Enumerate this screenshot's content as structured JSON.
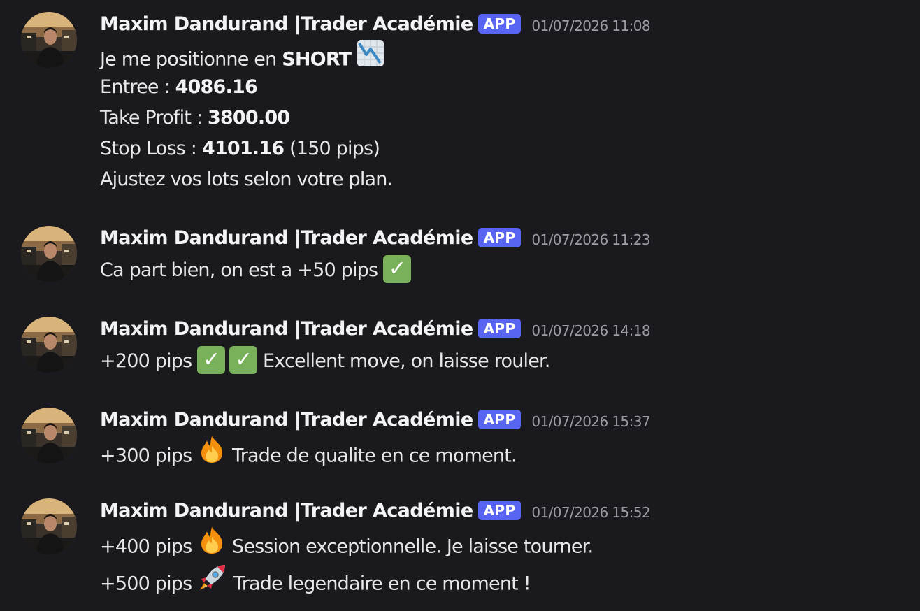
{
  "author": {
    "name": "Maxim Dandurand |Trader Académie",
    "badge": "APP"
  },
  "colors": {
    "background": "#1a1a1e",
    "badge": "#5865f2",
    "check_emoji": "#78b159"
  },
  "messages": [
    {
      "timestamp": "01/07/2026 11:08",
      "lines": [
        {
          "text": "Je me positionne en ",
          "bold": "SHORT",
          "emoji": "chart-decreasing"
        },
        {
          "text": "Entree : ",
          "bold": "4086.16"
        },
        {
          "text": "Take Profit : ",
          "bold": "3800.00"
        },
        {
          "text": "Stop Loss : ",
          "bold": "4101.16",
          "after": " (150 pips)"
        },
        {
          "text": "Ajustez vos lots selon votre plan."
        }
      ]
    },
    {
      "timestamp": "01/07/2026 11:23",
      "lines": [
        {
          "text": "Ca part bien, on est a +50 pips",
          "emoji": "check-mark-button"
        }
      ]
    },
    {
      "timestamp": "01/07/2026 14:18",
      "lines": [
        {
          "text": "+200 pips",
          "emoji": "check-mark-button-x2",
          "after": "Excellent move, on laisse rouler."
        }
      ]
    },
    {
      "timestamp": "01/07/2026 15:37",
      "lines": [
        {
          "text": "+300 pips",
          "emoji": "fire",
          "after": "Trade de qualite en ce moment."
        }
      ]
    },
    {
      "timestamp": "01/07/2026 15:52",
      "lines": [
        {
          "text": "+400 pips",
          "emoji": "fire",
          "after": "Session exceptionnelle. Je laisse tourner."
        },
        {
          "text": "+500 pips",
          "emoji": "rocket",
          "after": "Trade legendaire en ce moment !"
        }
      ]
    }
  ]
}
